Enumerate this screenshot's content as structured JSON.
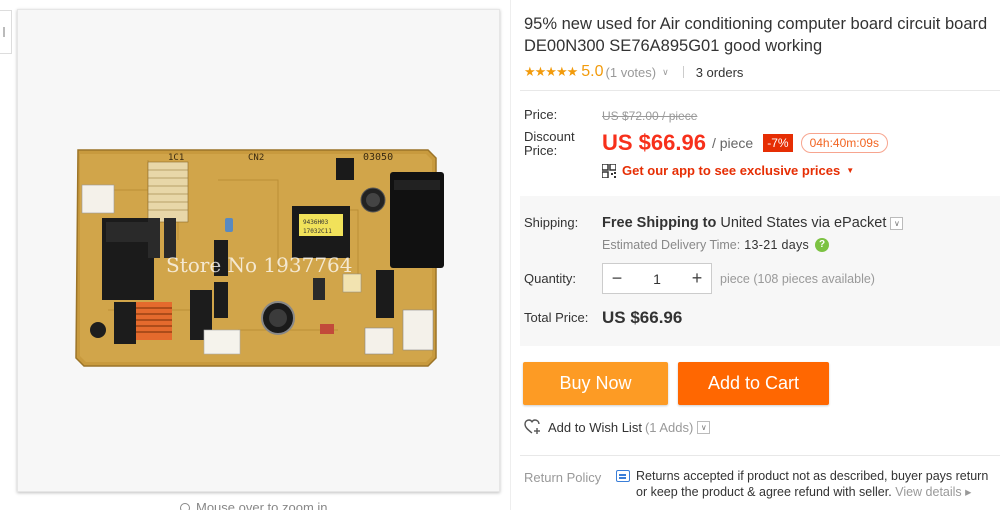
{
  "gallery": {
    "watermark": "Store No 1937764",
    "zoom_hint": "Mouse over to zoom in",
    "board_print": {
      "left_code": "1C1",
      "top_code": "CN2",
      "right_code": "03050",
      "chip_code_1": "9436H03",
      "chip_code_2": "17032C11"
    }
  },
  "product": {
    "title_line1": "95% new used for Air conditioning computer board circuit board",
    "title_line2": "DE00N300 SE76A895G01 good working",
    "stars": "★★★★★",
    "rating": "5.0",
    "votes": "(1 votes)",
    "orders": "3 orders"
  },
  "pricing": {
    "price_label": "Price:",
    "original_price": "US $72.00 / piece",
    "discount_label_1": "Discount",
    "discount_label_2": "Price:",
    "discount_price": "US $66.96",
    "per_piece": "/ piece",
    "discount_badge": "-7%",
    "countdown": "04h:40m:09s",
    "app_promo": "Get our app to see exclusive prices"
  },
  "shipping": {
    "label": "Shipping:",
    "free": "Free Shipping",
    "to": "to",
    "destination": "United States",
    "via": "via",
    "method": "ePacket",
    "est_label": "Estimated Delivery Time:",
    "est_days": "13-21 days"
  },
  "quantity": {
    "label": "Quantity:",
    "minus": "−",
    "value": "1",
    "plus": "+",
    "availability": "piece (108 pieces available)"
  },
  "total": {
    "label": "Total Price:",
    "value": "US $66.96"
  },
  "actions": {
    "buy_now": "Buy Now",
    "add_to_cart": "Add to Cart",
    "wish_list": "Add to Wish List",
    "wish_count": "(1 Adds)"
  },
  "return_policy": {
    "label": "Return Policy",
    "line1": "Returns accepted if product not as described, buyer pays return",
    "line2": "or keep the product & agree refund with seller.",
    "view_details": "View details ▸"
  },
  "colors": {
    "price_red": "#f7301b",
    "buy_now_orange": "#fd9b24",
    "add_to_cart_orange": "#ff6701",
    "star_gold": "#f29b0c"
  }
}
